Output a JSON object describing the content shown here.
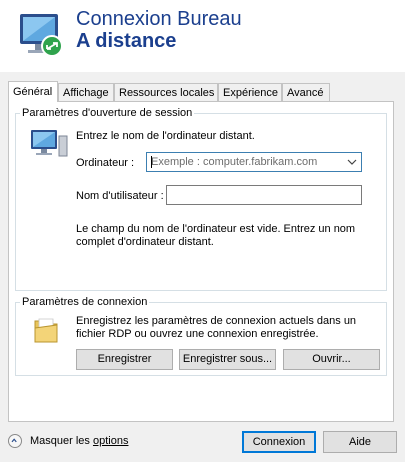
{
  "header": {
    "title_line1": "Connexion Bureau",
    "title_line2": "A distance"
  },
  "tabs": [
    {
      "label": "Général",
      "active": true
    },
    {
      "label": "Affichage",
      "active": false
    },
    {
      "label": "Ressources locales",
      "active": false
    },
    {
      "label": "Expérience",
      "active": false
    },
    {
      "label": "Avancé",
      "active": false
    }
  ],
  "session": {
    "group_title": "Paramètres d'ouverture de session",
    "instruction": "Entrez le nom de l'ordinateur distant.",
    "computer_label": "Ordinateur :",
    "computer_placeholder": "Exemple : computer.fabrikam.com",
    "username_label": "Nom d'utilisateur :",
    "username_value": "",
    "hint_line1": "Le champ du nom de l'ordinateur est vide. Entrez un nom",
    "hint_line2": "complet d'ordinateur distant."
  },
  "connection": {
    "group_title": "Paramètres de connexion",
    "desc_line1": "Enregistrez les paramètres de connexion actuels dans un",
    "desc_line2": "fichier RDP ou ouvrez une connexion enregistrée.",
    "save_label": "Enregistrer",
    "save_as_label": "Enregistrer sous...",
    "open_label": "Ouvrir..."
  },
  "footer": {
    "toggle_prefix": "Masquer les ",
    "toggle_underlined": "options",
    "connect_label": "Connexion",
    "help_label": "Aide"
  },
  "colors": {
    "title_blue": "#1b3f8e",
    "focus_border": "#3c7fb1",
    "default_button_border": "#0078d7"
  },
  "icons": [
    "remote-desktop-logo-icon",
    "computer-icon",
    "folder-icon",
    "chevron-down-icon",
    "chevron-up-circle-icon"
  ]
}
